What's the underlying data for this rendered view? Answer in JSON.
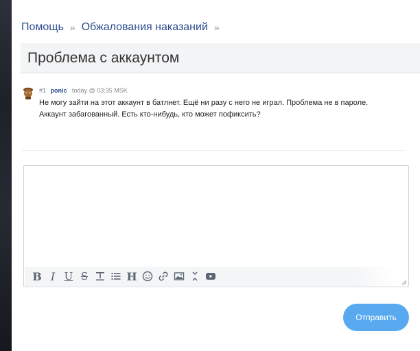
{
  "breadcrumb": {
    "items": [
      "Помощь",
      "Обжалования наказаний"
    ],
    "separator": "»"
  },
  "thread": {
    "title": "Проблема с аккаунтом"
  },
  "post": {
    "number": "#1",
    "author": "ponic",
    "timestamp": "today @ 03:35 MSK",
    "body_line1": "Не могу зайти на этот аккаунт в батлнет. Ещё ни разу с него не играл. Проблема не в пароле.",
    "body_line2": "Аккаунт забагованный. Есть кто-нибудь, кто может пофиксить?"
  },
  "editor": {
    "value": "",
    "toolbar": [
      "bold-icon",
      "italic-icon",
      "underline-icon",
      "strikethrough-icon",
      "text-align-icon",
      "list-icon",
      "heading-icon",
      "emoji-icon",
      "link-icon",
      "image-icon",
      "collapse-icon",
      "video-icon"
    ]
  },
  "actions": {
    "submit_label": "Отправить"
  },
  "colors": {
    "link": "#2a4b8d",
    "button": "#59a9f0",
    "title_bar": "#f3f4f6"
  }
}
